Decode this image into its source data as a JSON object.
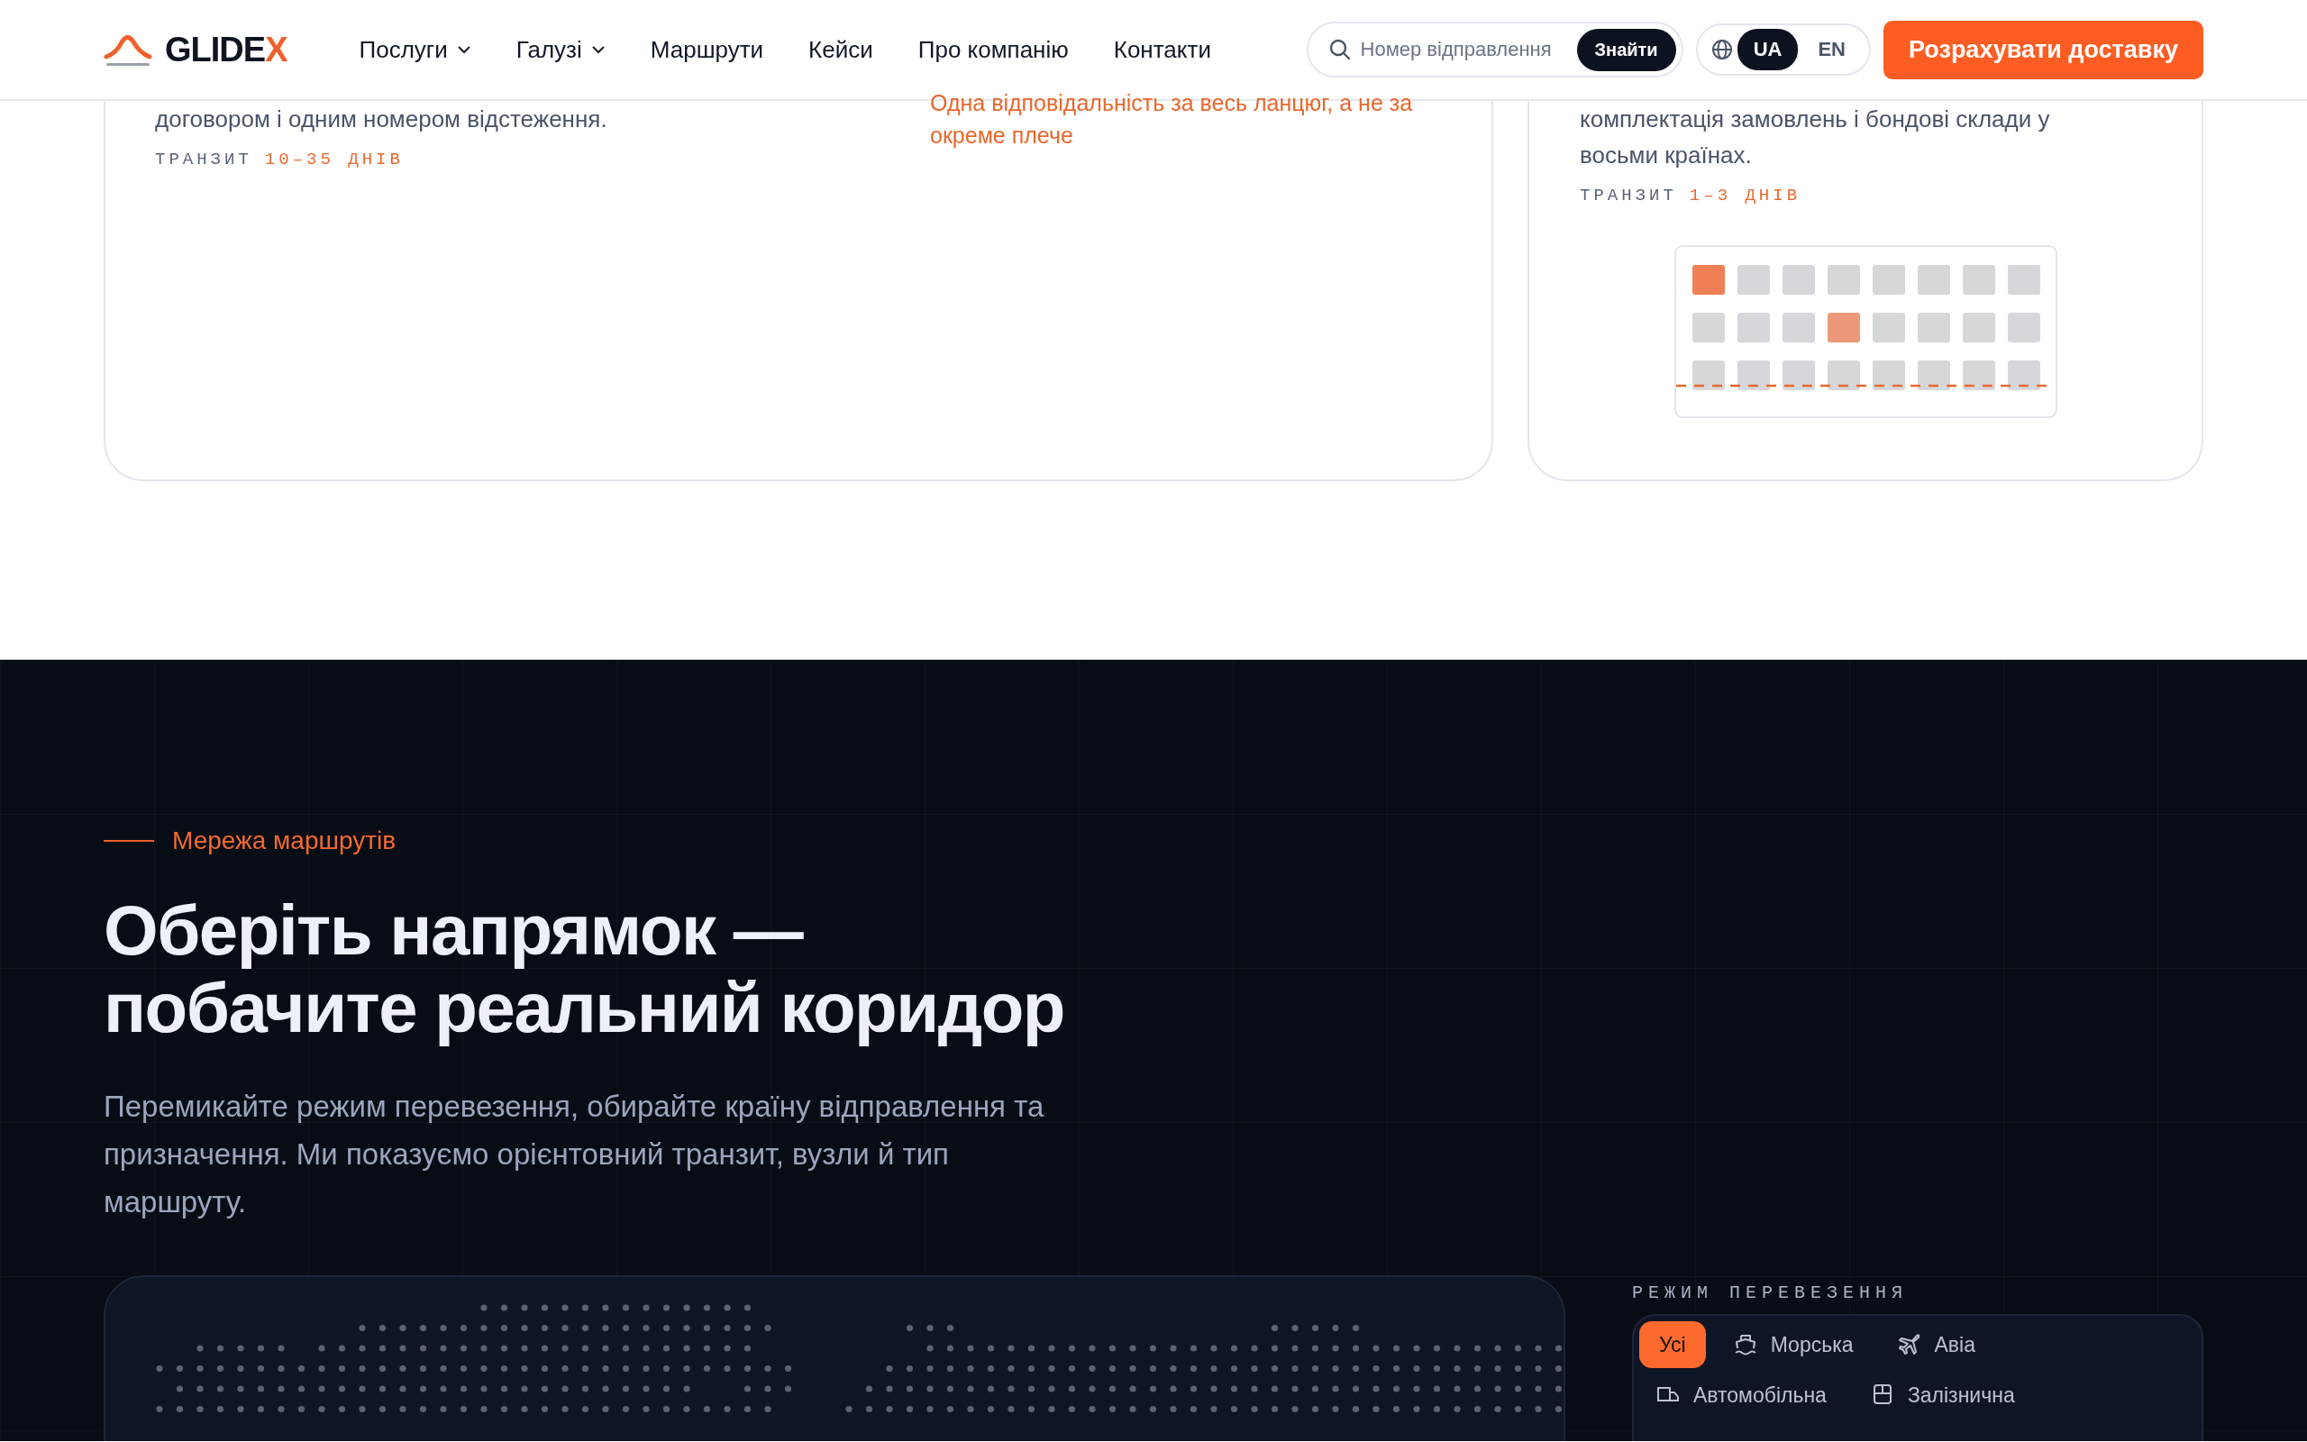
{
  "header": {
    "logo": {
      "text": "GLIDE",
      "accent": "X"
    },
    "nav": [
      {
        "label": "Послуги",
        "dropdown": true
      },
      {
        "label": "Галузі",
        "dropdown": true
      },
      {
        "label": "Маршрути",
        "dropdown": false
      },
      {
        "label": "Кейси",
        "dropdown": false
      },
      {
        "label": "Про компанію",
        "dropdown": false
      },
      {
        "label": "Контакти",
        "dropdown": false
      }
    ],
    "search": {
      "placeholder": "Номер відправлення",
      "button": "Знайти"
    },
    "languages": [
      {
        "label": "UA",
        "selected": true
      },
      {
        "label": "EN",
        "selected": false
      }
    ],
    "cta": "Розрахувати доставку"
  },
  "cards": [
    {
      "columns": [
        {
          "lines": [
            "договором і одним номером відстеження."
          ],
          "transit_label": "ТРАНЗИТ",
          "transit_value": "10–35 ДНІВ"
        },
        {
          "accent_text": "Одна відповідальність за весь ланцюг, а не за окреме плече"
        }
      ]
    },
    {
      "columns": [
        {
          "lines": [
            "комплектація замовлень і бондові склади у",
            "восьми країнах."
          ],
          "transit_label": "ТРАНЗИТ",
          "transit_value": "1–3 ДНІВ"
        }
      ]
    }
  ],
  "routes": {
    "eyebrow": "Мережа маршрутів",
    "title_lines": [
      "Оберіть напрямок —",
      "побачите реальний коридор"
    ],
    "description": "Перемикайте режим перевезення, обирайте країну відправлення та призначення. Ми показуємо орієнтовний транзит, вузли й тип маршруту.",
    "mode_label": "РЕЖИМ ПЕРЕВЕЗЕННЯ",
    "modes": [
      {
        "kind": "all",
        "label": "Усі",
        "selected": true
      },
      {
        "kind": "sea",
        "label": "Морська",
        "selected": false
      },
      {
        "kind": "air",
        "label": "Авіа",
        "selected": false
      },
      {
        "kind": "road",
        "label": "Автомобільна",
        "selected": false
      },
      {
        "kind": "rail",
        "label": "Залізнична",
        "selected": false
      }
    ]
  }
}
